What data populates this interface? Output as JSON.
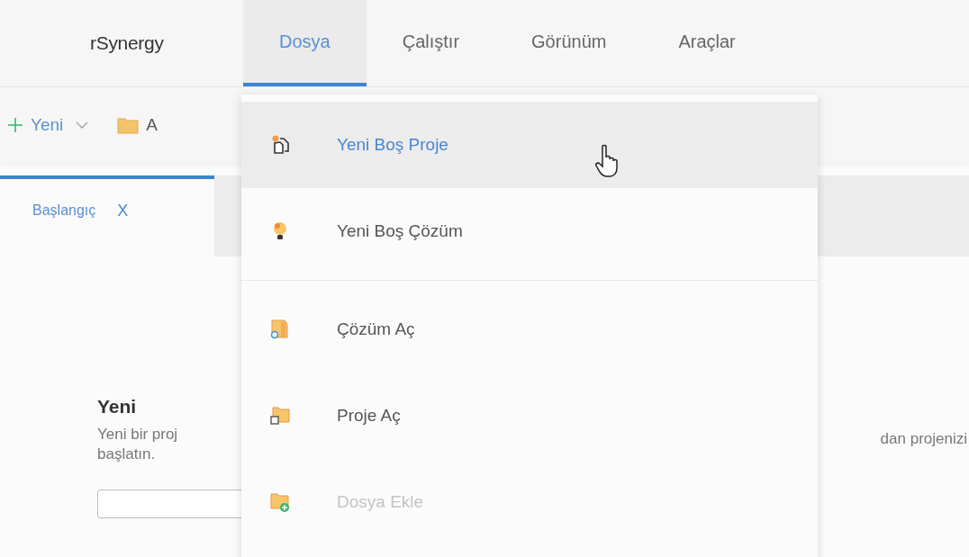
{
  "brand": "rSynergy",
  "menu": [
    {
      "label": "Dosya",
      "selected": true
    },
    {
      "label": "Çalıştır",
      "selected": false
    },
    {
      "label": "Görünüm",
      "selected": false
    },
    {
      "label": "Araçlar",
      "selected": false
    }
  ],
  "toolbar": {
    "new_button": "Yeni",
    "open_button": "A"
  },
  "tabs": [
    {
      "label": "Başlangıç",
      "selected": true,
      "close": "X"
    }
  ],
  "section": {
    "title": "Yeni",
    "description_lines": [
      "Yeni bir proj",
      "başlatın."
    ],
    "description_right": "dan projenizi"
  },
  "dropdown": [
    {
      "label": "Yeni Boş Proje",
      "kind": "new-project",
      "selected": true,
      "disabled": false,
      "separator_after": false
    },
    {
      "label": "Yeni Boş Çözüm",
      "kind": "new-solution",
      "selected": false,
      "disabled": false,
      "separator_after": true
    },
    {
      "label": "Çözüm Aç",
      "kind": "open-solution",
      "selected": false,
      "disabled": false,
      "separator_after": false
    },
    {
      "label": "Proje Aç",
      "kind": "open-project",
      "selected": false,
      "disabled": false,
      "separator_after": false
    },
    {
      "label": "Dosya Ekle",
      "kind": "add-file",
      "selected": false,
      "disabled": true,
      "separator_after": false
    }
  ]
}
